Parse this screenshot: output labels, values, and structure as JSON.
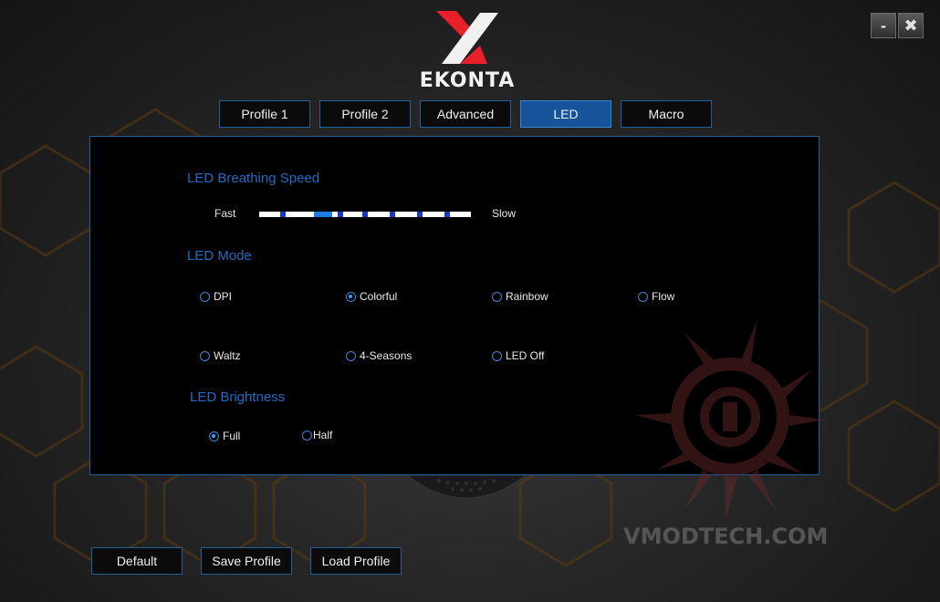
{
  "brand": {
    "logo_text": "EKONTA",
    "accent": "#e8202a"
  },
  "window": {
    "minimize_label": "-",
    "close_label": "✖"
  },
  "tabs": [
    {
      "label": "Profile 1",
      "active": false
    },
    {
      "label": "Profile 2",
      "active": false
    },
    {
      "label": "Advanced",
      "active": false
    },
    {
      "label": "LED",
      "active": true
    },
    {
      "label": "Macro",
      "active": false
    }
  ],
  "led": {
    "breathing": {
      "title": "LED Breathing Speed",
      "min_label": "Fast",
      "max_label": "Slow",
      "steps": 8,
      "selected_step": 2
    },
    "mode": {
      "title": "LED Mode",
      "options": [
        "DPI",
        "Colorful",
        "Rainbow",
        "Flow",
        "Waltz",
        "4-Seasons",
        "LED Off"
      ],
      "selected": "Colorful"
    },
    "brightness": {
      "title": "LED Brightness",
      "options": [
        "Full",
        "Half"
      ],
      "selected": "Full"
    }
  },
  "footer": {
    "default_label": "Default",
    "save_label": "Save Profile",
    "load_label": "Load Profile"
  },
  "watermark": {
    "text": "VMODTECH.COM"
  },
  "colors": {
    "accent_blue": "#1f6cc4",
    "active_tab": "#16539a",
    "border": "#1f5f9a"
  }
}
